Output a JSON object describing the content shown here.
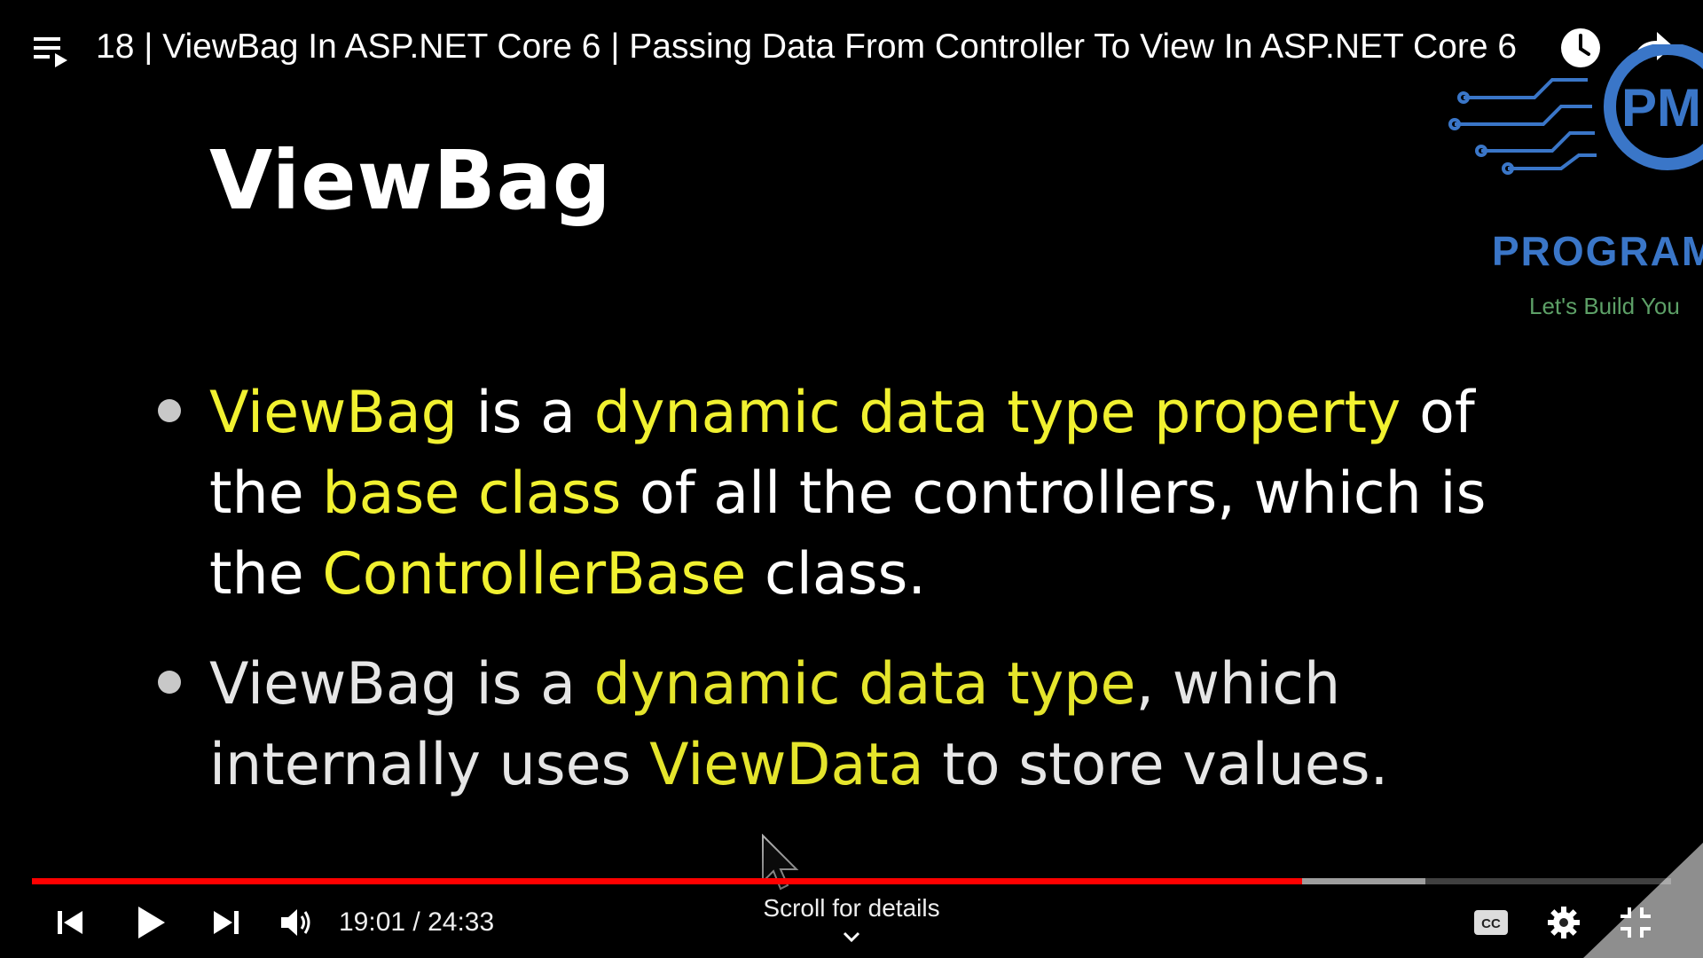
{
  "header": {
    "title": "18 | ViewBag In ASP.NET Core 6 | Passing Data From Controller To View In ASP.NET Core 6",
    "playlist_icon": "playlist-icon",
    "watch_later_icon": "clock-icon",
    "share_icon": "share-arrow-icon"
  },
  "channel_logo": {
    "monogram": "PM",
    "name": "PROGRAM",
    "tagline": "Let's Build You",
    "accent": "#3a76c8",
    "tagline_color": "#5da067"
  },
  "slide": {
    "title": "ViewBag",
    "bullets": [
      {
        "parts": [
          {
            "text": "ViewBag",
            "highlight": true
          },
          {
            "text": " is a ",
            "highlight": false
          },
          {
            "text": "dynamic data type property",
            "highlight": true
          },
          {
            "text": " of the ",
            "highlight": false
          },
          {
            "text": "base class",
            "highlight": true
          },
          {
            "text": " of all the controllers, which is the ",
            "highlight": false
          },
          {
            "text": "ControllerBase",
            "highlight": true
          },
          {
            "text": " class.",
            "highlight": false
          }
        ]
      },
      {
        "parts": [
          {
            "text": "ViewBag is a ",
            "highlight": false
          },
          {
            "text": "dynamic data type",
            "highlight": true
          },
          {
            "text": ", which internally uses ",
            "highlight": false
          },
          {
            "text": "ViewData",
            "highlight": true
          },
          {
            "text": " to store values.",
            "highlight": false
          }
        ]
      }
    ],
    "highlight_color": "#f1f130"
  },
  "player": {
    "current_time": "19:01",
    "duration": "24:33",
    "time_label": "19:01 / 24:33",
    "progress_fraction": 0.775,
    "buffered_fraction": 0.85,
    "scroll_hint": "Scroll for details",
    "progress_color": "#ff0000",
    "icons": [
      "previous-icon",
      "play-icon",
      "next-icon",
      "volume-icon",
      "cc-icon",
      "settings-gear-icon",
      "exit-fullscreen-icon"
    ]
  }
}
